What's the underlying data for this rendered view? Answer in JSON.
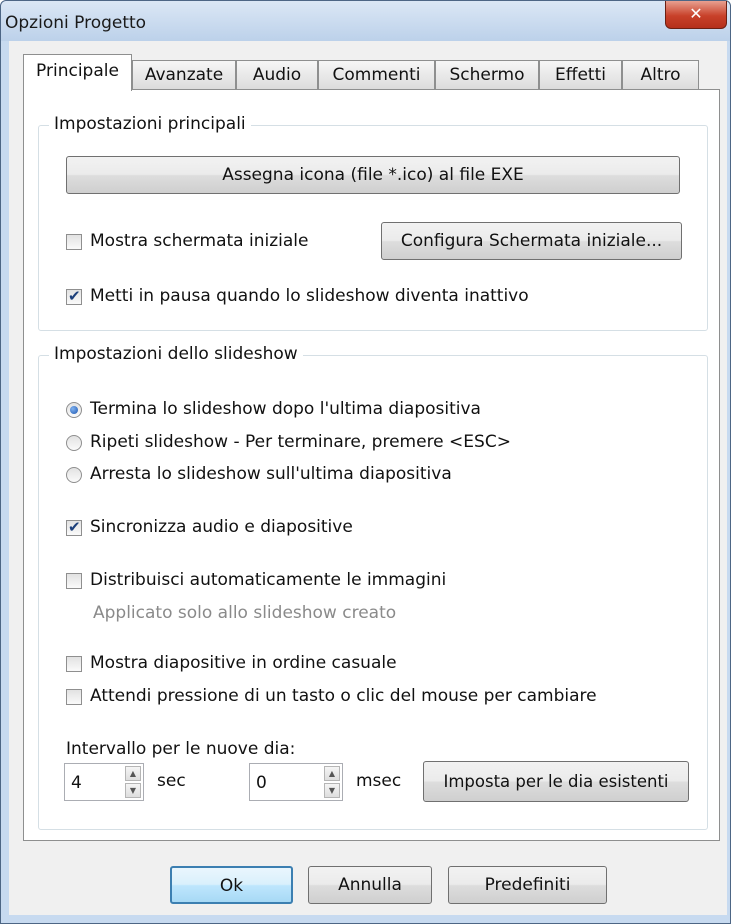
{
  "window": {
    "title": "Opzioni Progetto",
    "close_icon": "✕"
  },
  "tabs": [
    {
      "label": "Principale"
    },
    {
      "label": "Avanzate"
    },
    {
      "label": "Audio"
    },
    {
      "label": "Commenti"
    },
    {
      "label": "Schermo"
    },
    {
      "label": "Effetti"
    },
    {
      "label": "Altro"
    }
  ],
  "main_settings": {
    "legend": "Impostazioni principali",
    "assign_icon_button": "Assegna icona (file *.ico) al file EXE",
    "show_splash": {
      "label": "Mostra schermata iniziale",
      "checked": false
    },
    "configure_splash_button": "Configura Schermata iniziale...",
    "pause_inactive": {
      "label": "Metti in pausa quando lo slideshow diventa inattivo",
      "checked": true
    }
  },
  "slideshow_settings": {
    "legend": "Impostazioni dello slideshow",
    "end_options": [
      {
        "label": "Termina lo slideshow dopo l'ultima diapositiva",
        "selected": true
      },
      {
        "label": "Ripeti slideshow - Per terminare, premere <ESC>",
        "selected": false
      },
      {
        "label": "Arresta lo slideshow sull'ultima diapositiva",
        "selected": false
      }
    ],
    "sync_audio": {
      "label": "Sincronizza audio e diapositive",
      "checked": true
    },
    "auto_distribute": {
      "label": "Distribuisci automaticamente le immagini",
      "checked": false
    },
    "auto_distribute_hint": "Applicato solo allo slideshow creato",
    "random_order": {
      "label": "Mostra diapositive in ordine casuale",
      "checked": false
    },
    "wait_keypress": {
      "label": "Attendi pressione di un tasto o clic del mouse per cambiare",
      "checked": false
    },
    "interval_label": "Intervallo per le nuove dia:",
    "seconds_value": "4",
    "seconds_unit": "sec",
    "msec_value": "0",
    "msec_unit": "msec",
    "apply_existing_button": "Imposta per le dia esistenti"
  },
  "footer": {
    "ok_button": "Ok",
    "cancel_button": "Annulla",
    "defaults_button": "Predefiniti"
  }
}
